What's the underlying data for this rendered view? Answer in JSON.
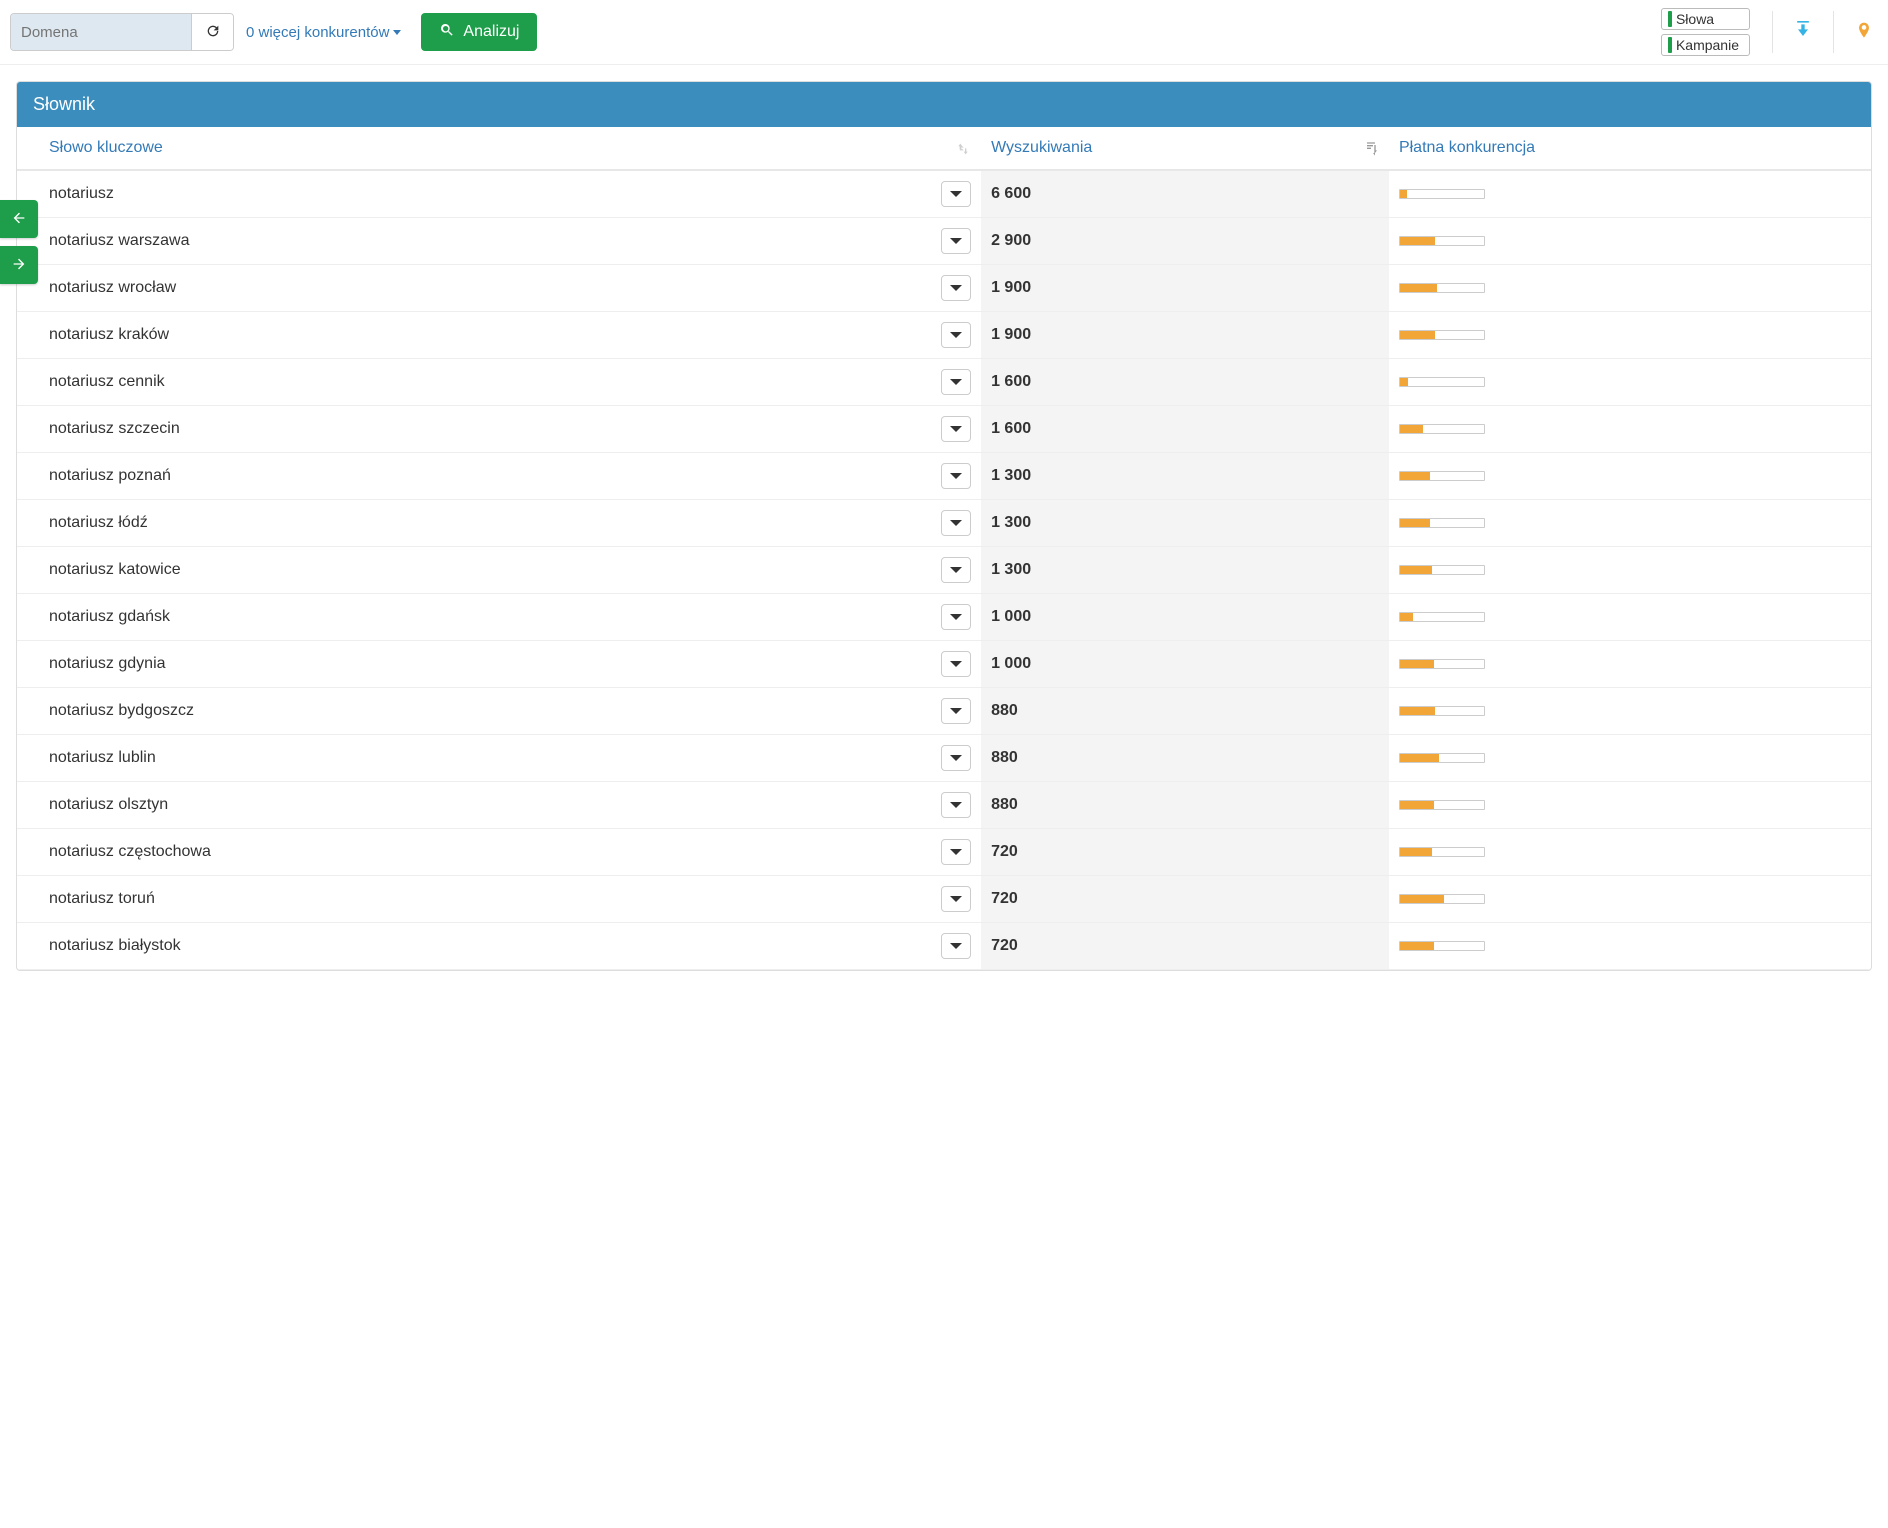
{
  "toolbar": {
    "domain_placeholder": "Domena",
    "competitors_label": "0 więcej konkurentów",
    "analyze_label": "Analizuj",
    "pill_words": "Słowa",
    "pill_campaigns": "Kampanie"
  },
  "panel": {
    "title": "Słownik",
    "columns": {
      "keyword": "Słowo kluczowe",
      "searches": "Wyszukiwania",
      "competition": "Płatna konkurencja"
    },
    "rows": [
      {
        "keyword": "notariusz",
        "searches": "6 600",
        "competition": 8
      },
      {
        "keyword": "notariusz warszawa",
        "searches": "2 900",
        "competition": 42
      },
      {
        "keyword": "notariusz wrocław",
        "searches": "1 900",
        "competition": 44
      },
      {
        "keyword": "notariusz kraków",
        "searches": "1 900",
        "competition": 42
      },
      {
        "keyword": "notariusz cennik",
        "searches": "1 600",
        "competition": 10
      },
      {
        "keyword": "notariusz szczecin",
        "searches": "1 600",
        "competition": 28
      },
      {
        "keyword": "notariusz poznań",
        "searches": "1 300",
        "competition": 36
      },
      {
        "keyword": "notariusz łódź",
        "searches": "1 300",
        "competition": 36
      },
      {
        "keyword": "notariusz katowice",
        "searches": "1 300",
        "competition": 38
      },
      {
        "keyword": "notariusz gdańsk",
        "searches": "1 000",
        "competition": 16
      },
      {
        "keyword": "notariusz gdynia",
        "searches": "1 000",
        "competition": 40
      },
      {
        "keyword": "notariusz bydgoszcz",
        "searches": "880",
        "competition": 42
      },
      {
        "keyword": "notariusz lublin",
        "searches": "880",
        "competition": 46
      },
      {
        "keyword": "notariusz olsztyn",
        "searches": "880",
        "competition": 40
      },
      {
        "keyword": "notariusz częstochowa",
        "searches": "720",
        "competition": 38
      },
      {
        "keyword": "notariusz toruń",
        "searches": "720",
        "competition": 52
      },
      {
        "keyword": "notariusz białystok",
        "searches": "720",
        "competition": 40
      }
    ]
  }
}
